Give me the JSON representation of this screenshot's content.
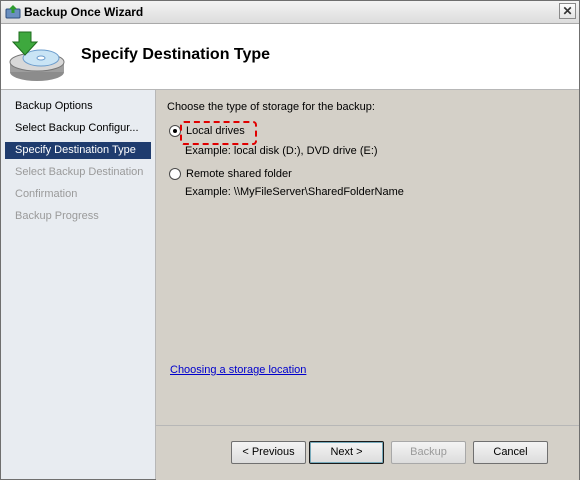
{
  "window": {
    "title": "Backup Once Wizard",
    "close_glyph": "✕"
  },
  "header": {
    "title": "Specify Destination Type",
    "icon": "backup-disc-icon"
  },
  "steps": [
    {
      "label": "Backup Options",
      "state": "done"
    },
    {
      "label": "Select Backup Configur...",
      "state": "done"
    },
    {
      "label": "Specify Destination Type",
      "state": "current"
    },
    {
      "label": "Select Backup Destination",
      "state": "future"
    },
    {
      "label": "Confirmation",
      "state": "future"
    },
    {
      "label": "Backup Progress",
      "state": "future"
    }
  ],
  "main": {
    "prompt": "Choose the type of storage for the backup:",
    "options": [
      {
        "label": "Local drives",
        "example": "Example: local disk (D:), DVD drive (E:)",
        "selected": true
      },
      {
        "label": "Remote shared folder",
        "example": "Example: \\\\MyFileServer\\SharedFolderName",
        "selected": false
      }
    ],
    "link": "Choosing a storage location"
  },
  "buttons": {
    "previous": "< Previous",
    "next": "Next >",
    "backup": "Backup",
    "cancel": "Cancel"
  },
  "colors": {
    "current_step_bg": "#1f3c6e",
    "highlight_border": "#e00000",
    "link": "#0000cc"
  }
}
